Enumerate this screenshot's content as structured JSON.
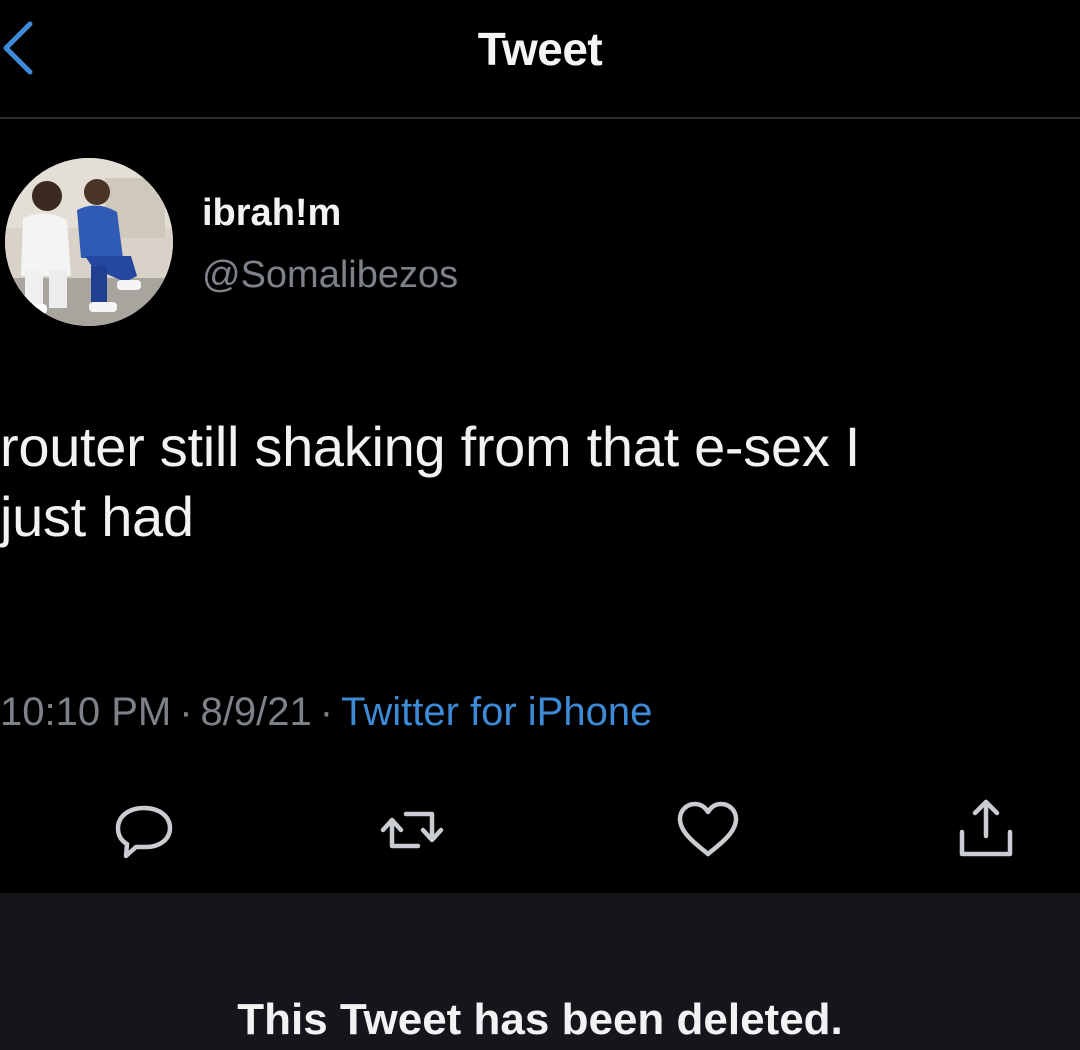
{
  "header": {
    "title": "Tweet",
    "back_icon": "chevron-left-icon",
    "accent_color": "#3d8ad6"
  },
  "author": {
    "display_name": "ibrah!m",
    "handle": "@Somalibezos",
    "avatar": "avatar-photo"
  },
  "tweet": {
    "text_line_1": "router still shaking from that e-sex I",
    "text_line_2": "just had",
    "time": "10:10 PM",
    "separator": "·",
    "date": "8/9/21",
    "source": "Twitter for iPhone"
  },
  "actions": [
    {
      "icon": "reply-icon"
    },
    {
      "icon": "retweet-icon"
    },
    {
      "icon": "heart-icon"
    },
    {
      "icon": "share-icon"
    }
  ],
  "banner": {
    "message": "This Tweet has been deleted."
  },
  "colors": {
    "background": "#000000",
    "text": "#f2f2f2",
    "secondary_text": "#7c8288",
    "link": "#3d8ad6",
    "banner_background": "#15161b"
  }
}
